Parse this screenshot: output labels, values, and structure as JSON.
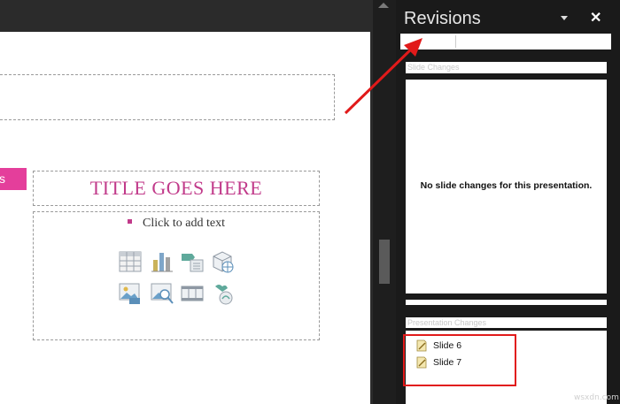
{
  "slide": {
    "pink_strip_text": "s",
    "layout_title": "TITLE GOES HERE",
    "content_prompt": "Click to add text",
    "insert_icons": [
      "table-icon",
      "chart-icon",
      "smartart-icon",
      "online-picture-icon",
      "picture-icon",
      "online-image-icon",
      "video-icon",
      "icons-insert-icon"
    ]
  },
  "revisions_pane": {
    "title": "Revisions",
    "slide_changes_label": "Slide Changes",
    "no_changes_message": "No slide changes for this presentation.",
    "presentation_changes_label": "Presentation Changes",
    "items": [
      {
        "label": "Slide 6"
      },
      {
        "label": "Slide 7"
      }
    ]
  },
  "colors": {
    "accent_pink": "#e43e9b",
    "title_magenta": "#c13a8a",
    "annotation_red": "#e11a1a"
  },
  "watermark": "wsxdn.com"
}
